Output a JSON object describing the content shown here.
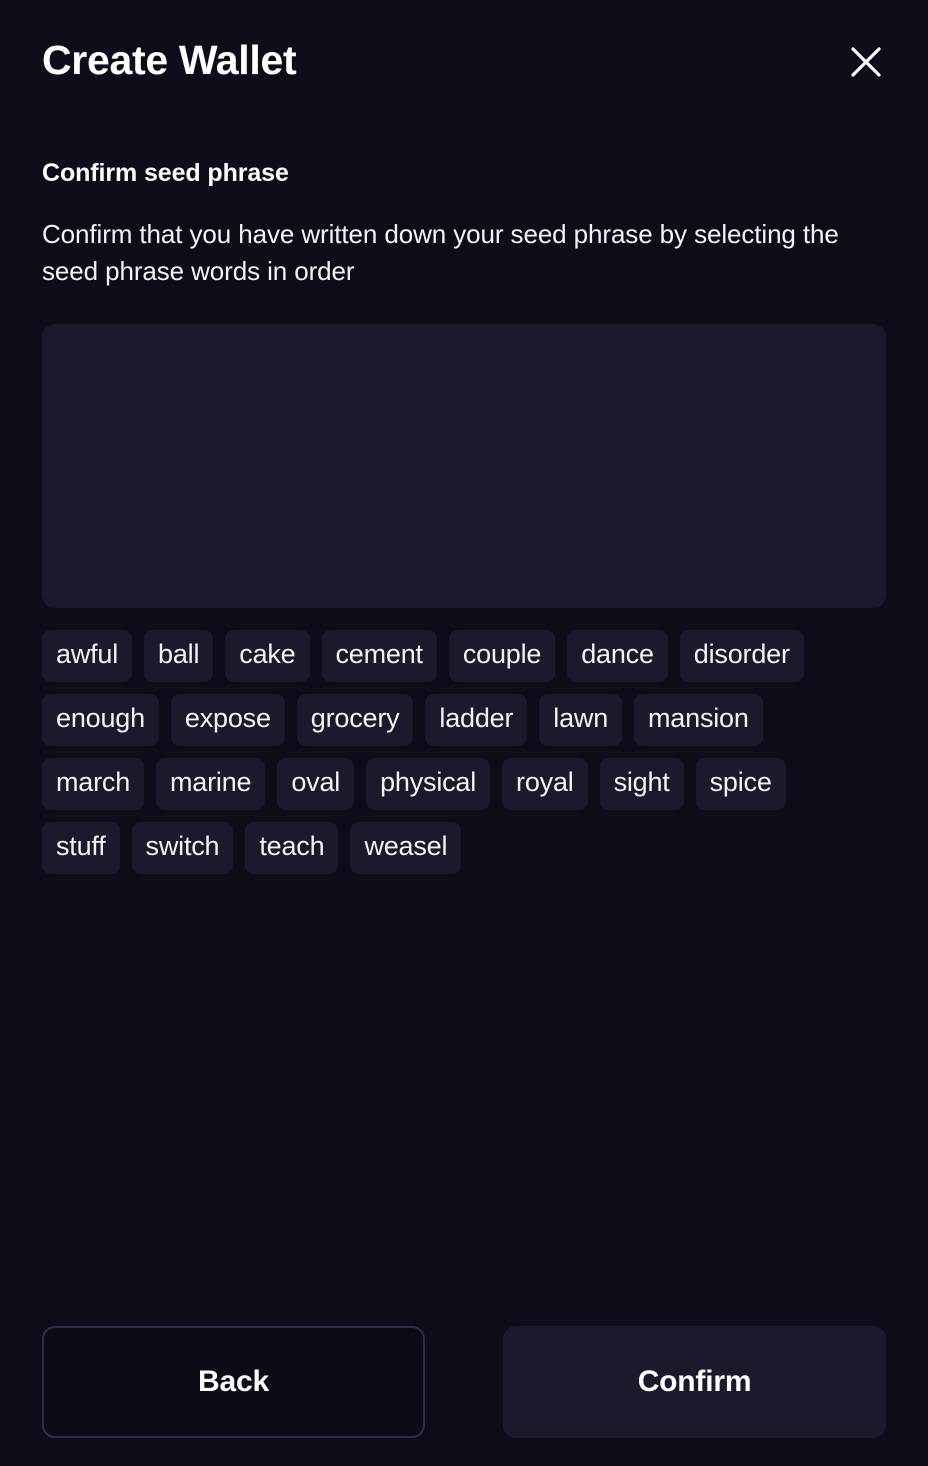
{
  "header": {
    "title": "Create Wallet",
    "close_label": "Close",
    "close_icon": "close-icon"
  },
  "content": {
    "section_title": "Confirm seed phrase",
    "description": "Confirm that you have written down your seed phrase by selecting the seed phrase words in order"
  },
  "selected_words": [],
  "word_bank": [
    "awful",
    "ball",
    "cake",
    "cement",
    "couple",
    "dance",
    "disorder",
    "enough",
    "expose",
    "grocery",
    "ladder",
    "lawn",
    "mansion",
    "march",
    "marine",
    "oval",
    "physical",
    "royal",
    "sight",
    "spice",
    "stuff",
    "switch",
    "teach",
    "weasel"
  ],
  "footer": {
    "back_label": "Back",
    "confirm_label": "Confirm"
  },
  "colors": {
    "page_background": "#0d0d1a",
    "surface": "#191b2c",
    "border": "#2c2e44",
    "text_primary": "#ffffff",
    "text_secondary": "#f2f2f7"
  }
}
